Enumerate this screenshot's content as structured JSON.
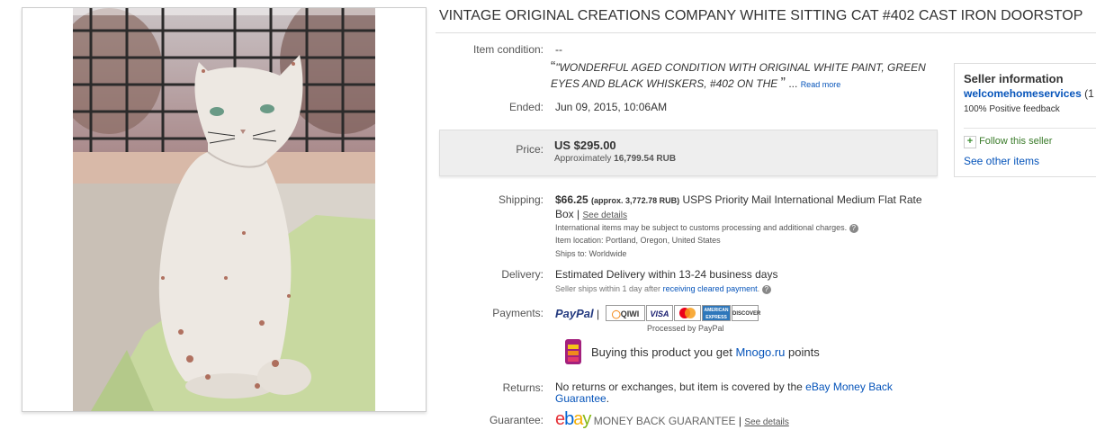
{
  "listing": {
    "title": "VINTAGE ORIGINAL CREATIONS COMPANY WHITE SITTING CAT #402 CAST IRON DOORSTOP"
  },
  "condition": {
    "label": "Item condition:",
    "value": "--",
    "quote": "\"WONDERFUL AGED CONDITION WITH ORIGINAL WHITE PAINT, GREEN EYES AND BLACK WHISKERS, #402 ON THE",
    "open_quote": "“",
    "close_quote": "”",
    "ellipsis": "...",
    "read_more": "Read more"
  },
  "ended": {
    "label": "Ended:",
    "value": "Jun 09, 2015, 10:06AM"
  },
  "price": {
    "label": "Price:",
    "value": "US $295.00",
    "approx_prefix": "Approximately",
    "approx_value": "16,799.54 RUB"
  },
  "shipping": {
    "label": "Shipping:",
    "amount": "$66.25",
    "approx": "(approx. 3,772.78 RUB)",
    "method_line1": "USPS Priority Mail International Medium Flat",
    "method_line2": "Rate Box",
    "sep": "|",
    "see_details": "See details",
    "customs_note": "International items may be subject to customs processing and additional charges.",
    "location": "Item location: Portland, Oregon, United States",
    "ships_to": "Ships to: Worldwide"
  },
  "delivery": {
    "label": "Delivery:",
    "value": "Estimated Delivery within 13-24 business days",
    "note_prefix": "Seller ships within 1 day after",
    "note_link": "receiving cleared payment",
    "note_suffix": "."
  },
  "payments": {
    "label": "Payments:",
    "paypal": "PayPal",
    "sep": "|",
    "methods": [
      "QIWI",
      "VISA",
      "MC",
      "AMERICAN EXPRESS",
      "DISCOVER"
    ],
    "processed_by": "Processed by PayPal"
  },
  "mnogo": {
    "text": "Buying this product you get",
    "link": "Mnogo.ru",
    "suffix": "points"
  },
  "returns": {
    "label": "Returns:",
    "text": "No returns or exchanges, but item is covered by the",
    "link1": "eBay Money Back",
    "link2": "Guarantee",
    "suffix": "."
  },
  "guarantee": {
    "label": "Guarantee:",
    "brand": "ebay",
    "brand_text": "MONEY BACK GUARANTEE",
    "sep": "|",
    "see_details": "See details"
  },
  "seller": {
    "heading": "Seller information",
    "name": "welcomehomeservices",
    "score_fragment": "(1",
    "feedback": "100% Positive feedback",
    "follow": "Follow this seller",
    "other_items": "See other items"
  },
  "colors": {
    "link": "#0654ba",
    "price_band": "#eeeeee",
    "ebay_e": "#e53238",
    "ebay_b": "#0064d2",
    "ebay_a": "#f5af02",
    "ebay_y": "#86b817"
  }
}
